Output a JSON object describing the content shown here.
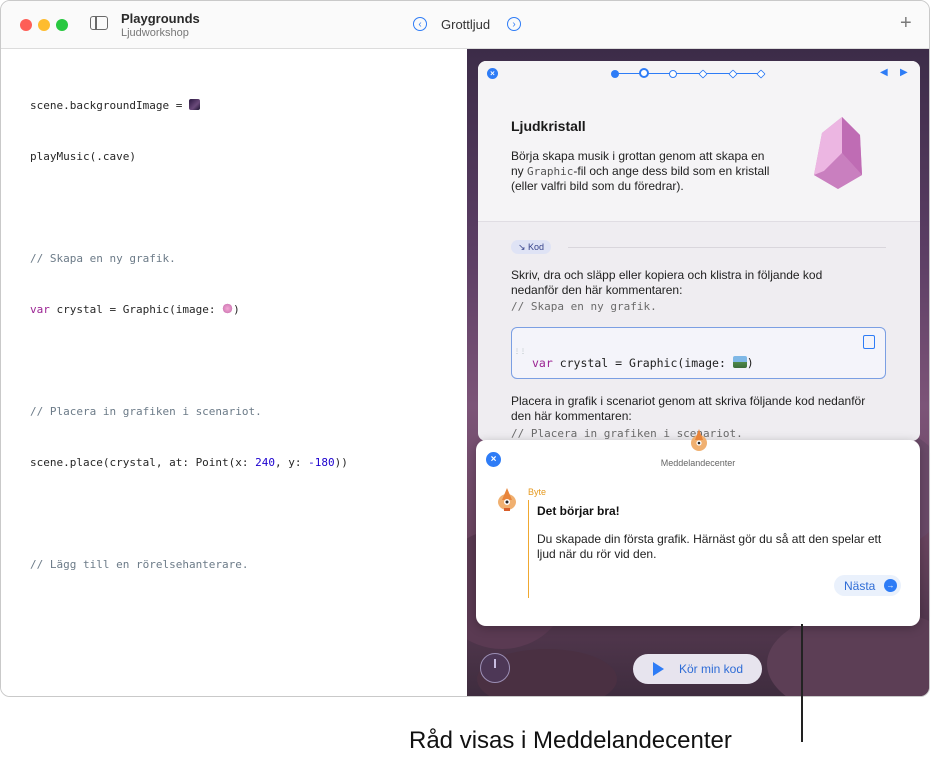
{
  "window": {
    "app_title": "Playgrounds",
    "app_subtitle": "Ljudworkshop",
    "page_name": "Grottljud",
    "nav_prev": "‹",
    "nav_next": "›",
    "add": "+"
  },
  "editor": {
    "lines": {
      "l1": "scene.backgroundImage = ",
      "l2": "playMusic(.cave)",
      "l3": "// Skapa en ny grafik.",
      "l4_kw": "var",
      "l4a": " crystal = Graphic(image: ",
      "l4b": ")",
      "l5": "// Placera in grafiken i scenariot.",
      "l6a": "scene.place(crystal, at: Point(x: ",
      "l6_x": "240",
      "l6b": ", y: ",
      "l6_y": "-180",
      "l6c": "))",
      "l7": "// Lägg till en rörelsehanterare."
    }
  },
  "guide": {
    "title": "Ljudkristall",
    "intro_a": "Börja skapa musik i grottan genom att skapa en ny ",
    "intro_mono": "Graphic",
    "intro_b": "-fil och ange dess bild som en kristall (eller valfri bild som du föredrar).",
    "kod_tag": "↘ Kod",
    "instruction1": "Skriv, dra och släpp eller kopiera och klistra in följande kod nedanför den här kommentaren:",
    "comment1": "// Skapa en ny grafik.",
    "snippet_kw": "var",
    "snippet_rest": " crystal = Graphic(image: ",
    "snippet_end": ")",
    "instruction2": "Placera in grafik i scenariot genom att skriva följande kod nedanför den här kommentaren:",
    "comment2": "// Placera in grafiken i scenariot.",
    "close": "×",
    "prev_arrow": "◀",
    "next_arrow": "▶"
  },
  "message_center": {
    "title": "Meddelandecenter",
    "sender": "Byte",
    "heading": "Det börjar bra!",
    "text": "Du skapade din första grafik. Härnäst gör du så att den spelar ett ljud när du rör vid den.",
    "next_label": "Nästa",
    "next_icon": "→",
    "close": "×"
  },
  "controls": {
    "run_label": "Kör min kod"
  },
  "caption": "Råd visas i Meddelandecenter",
  "colors": {
    "accent": "#2e7cf6",
    "byte_orange": "#e69a20",
    "keyword": "#9b2393",
    "number": "#1c00cf"
  }
}
